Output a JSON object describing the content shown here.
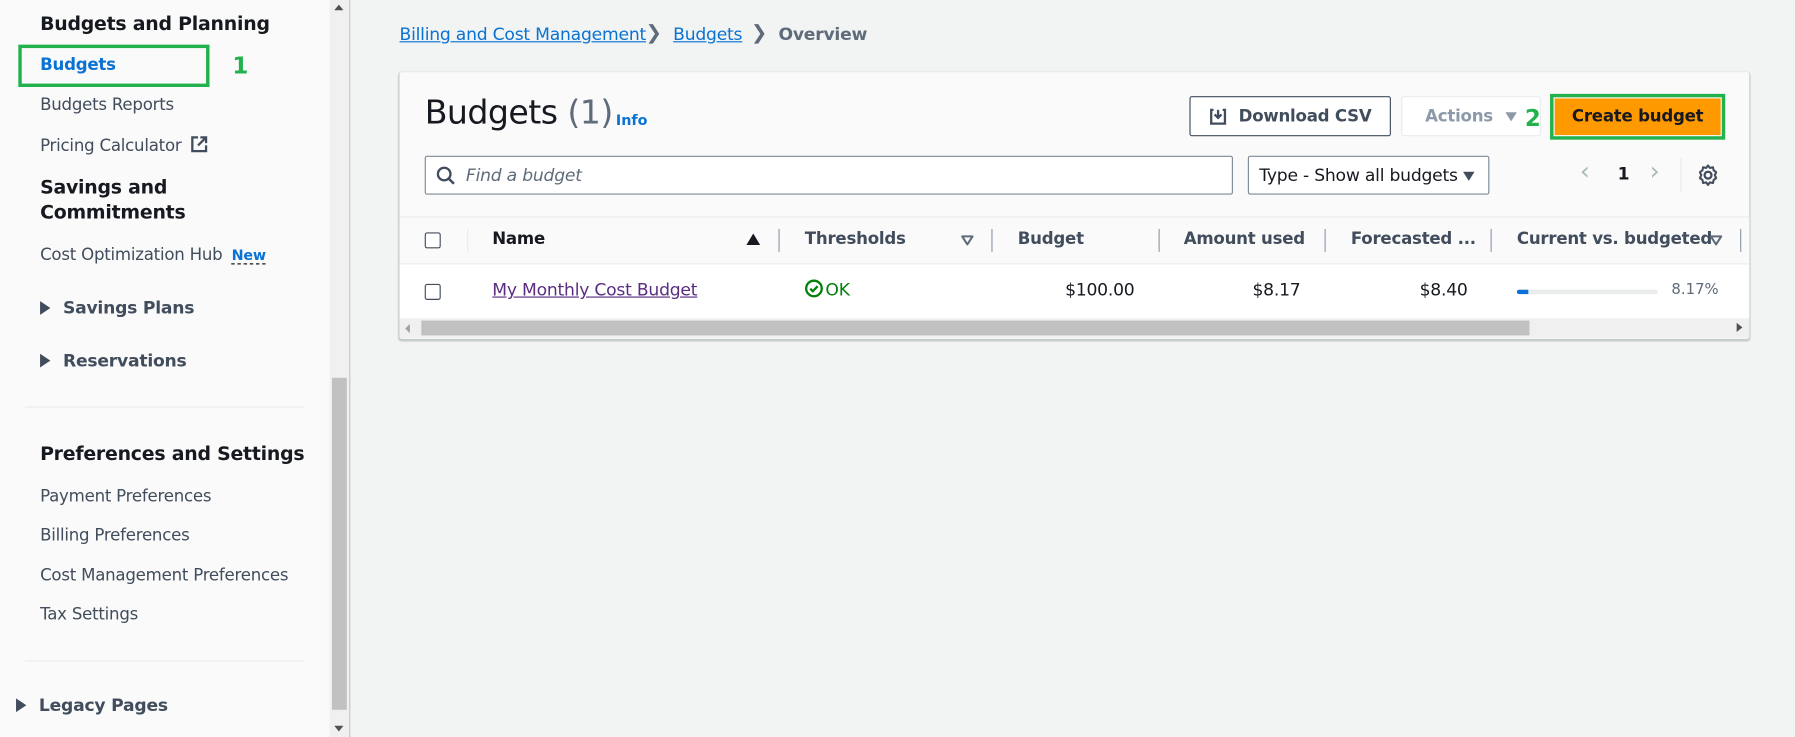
{
  "sidebar": {
    "section_budgets_planning": "Budgets and Planning",
    "items_budgets": [
      {
        "label": "Budgets",
        "active": true
      },
      {
        "label": "Budgets Reports"
      },
      {
        "label": "Pricing Calculator",
        "icon": "external-link-icon"
      }
    ],
    "section_savings_line1": "Savings and",
    "section_savings_line2": "Commitments",
    "cost_optimization_hub": "Cost Optimization Hub",
    "new_badge": "New",
    "expandables": [
      {
        "label": "Savings Plans"
      },
      {
        "label": "Reservations"
      }
    ],
    "section_preferences": "Preferences and Settings",
    "items_preferences": [
      {
        "label": "Payment Preferences"
      },
      {
        "label": "Billing Preferences"
      },
      {
        "label": "Cost Management Preferences"
      },
      {
        "label": "Tax Settings"
      }
    ],
    "legacy_pages": "Legacy Pages"
  },
  "annotations": {
    "step1": "1",
    "step2": "2",
    "highlight_color": "#22b14c"
  },
  "breadcrumb": {
    "items": [
      "Billing and Cost Management",
      "Budgets"
    ],
    "current": "Overview"
  },
  "header": {
    "title": "Budgets",
    "count": "(1)",
    "info": "Info",
    "download_csv": "Download CSV",
    "actions": "Actions",
    "create_budget": "Create budget",
    "primary_color": "#ff9900"
  },
  "filters": {
    "search_placeholder": "Find a budget",
    "type_select": "Type - Show all budgets",
    "page": "1"
  },
  "table": {
    "columns": [
      "Name",
      "Thresholds",
      "Budget",
      "Amount used",
      "Forecasted ...",
      "Current vs. budgeted"
    ],
    "rows": [
      {
        "name": "My Monthly Cost Budget",
        "threshold": "OK",
        "budget": "$100.00",
        "amount_used": "$8.17",
        "forecasted": "$8.40",
        "current_vs_budgeted": "8.17%",
        "progress_percent": 8.17
      }
    ]
  }
}
